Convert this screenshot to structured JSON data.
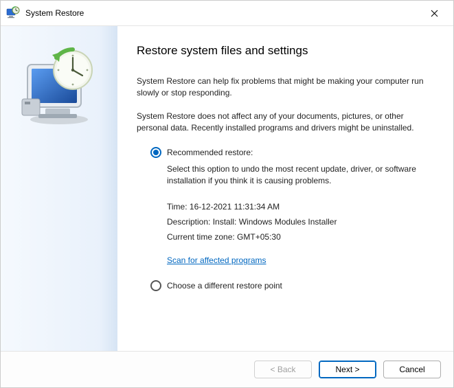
{
  "window": {
    "title": "System Restore"
  },
  "main": {
    "heading": "Restore system files and settings",
    "para1": "System Restore can help fix problems that might be making your computer run slowly or stop responding.",
    "para2": "System Restore does not affect any of your documents, pictures, or other personal data. Recently installed programs and drivers might be uninstalled."
  },
  "option_recommended": {
    "label": "Recommended restore:",
    "sub": "Select this option to undo the most recent update, driver, or software installation if you think it is causing problems.",
    "time_label": "Time: ",
    "time_value": "16-12-2021 11:31:34 AM",
    "desc_label": "Description: ",
    "desc_value": "Install: Windows Modules Installer",
    "tz_label": "Current time zone: ",
    "tz_value": "GMT+05:30",
    "scan_link": "Scan for affected programs"
  },
  "option_other": {
    "label": "Choose a different restore point"
  },
  "footer": {
    "back": "< Back",
    "next": "Next >",
    "cancel": "Cancel"
  }
}
